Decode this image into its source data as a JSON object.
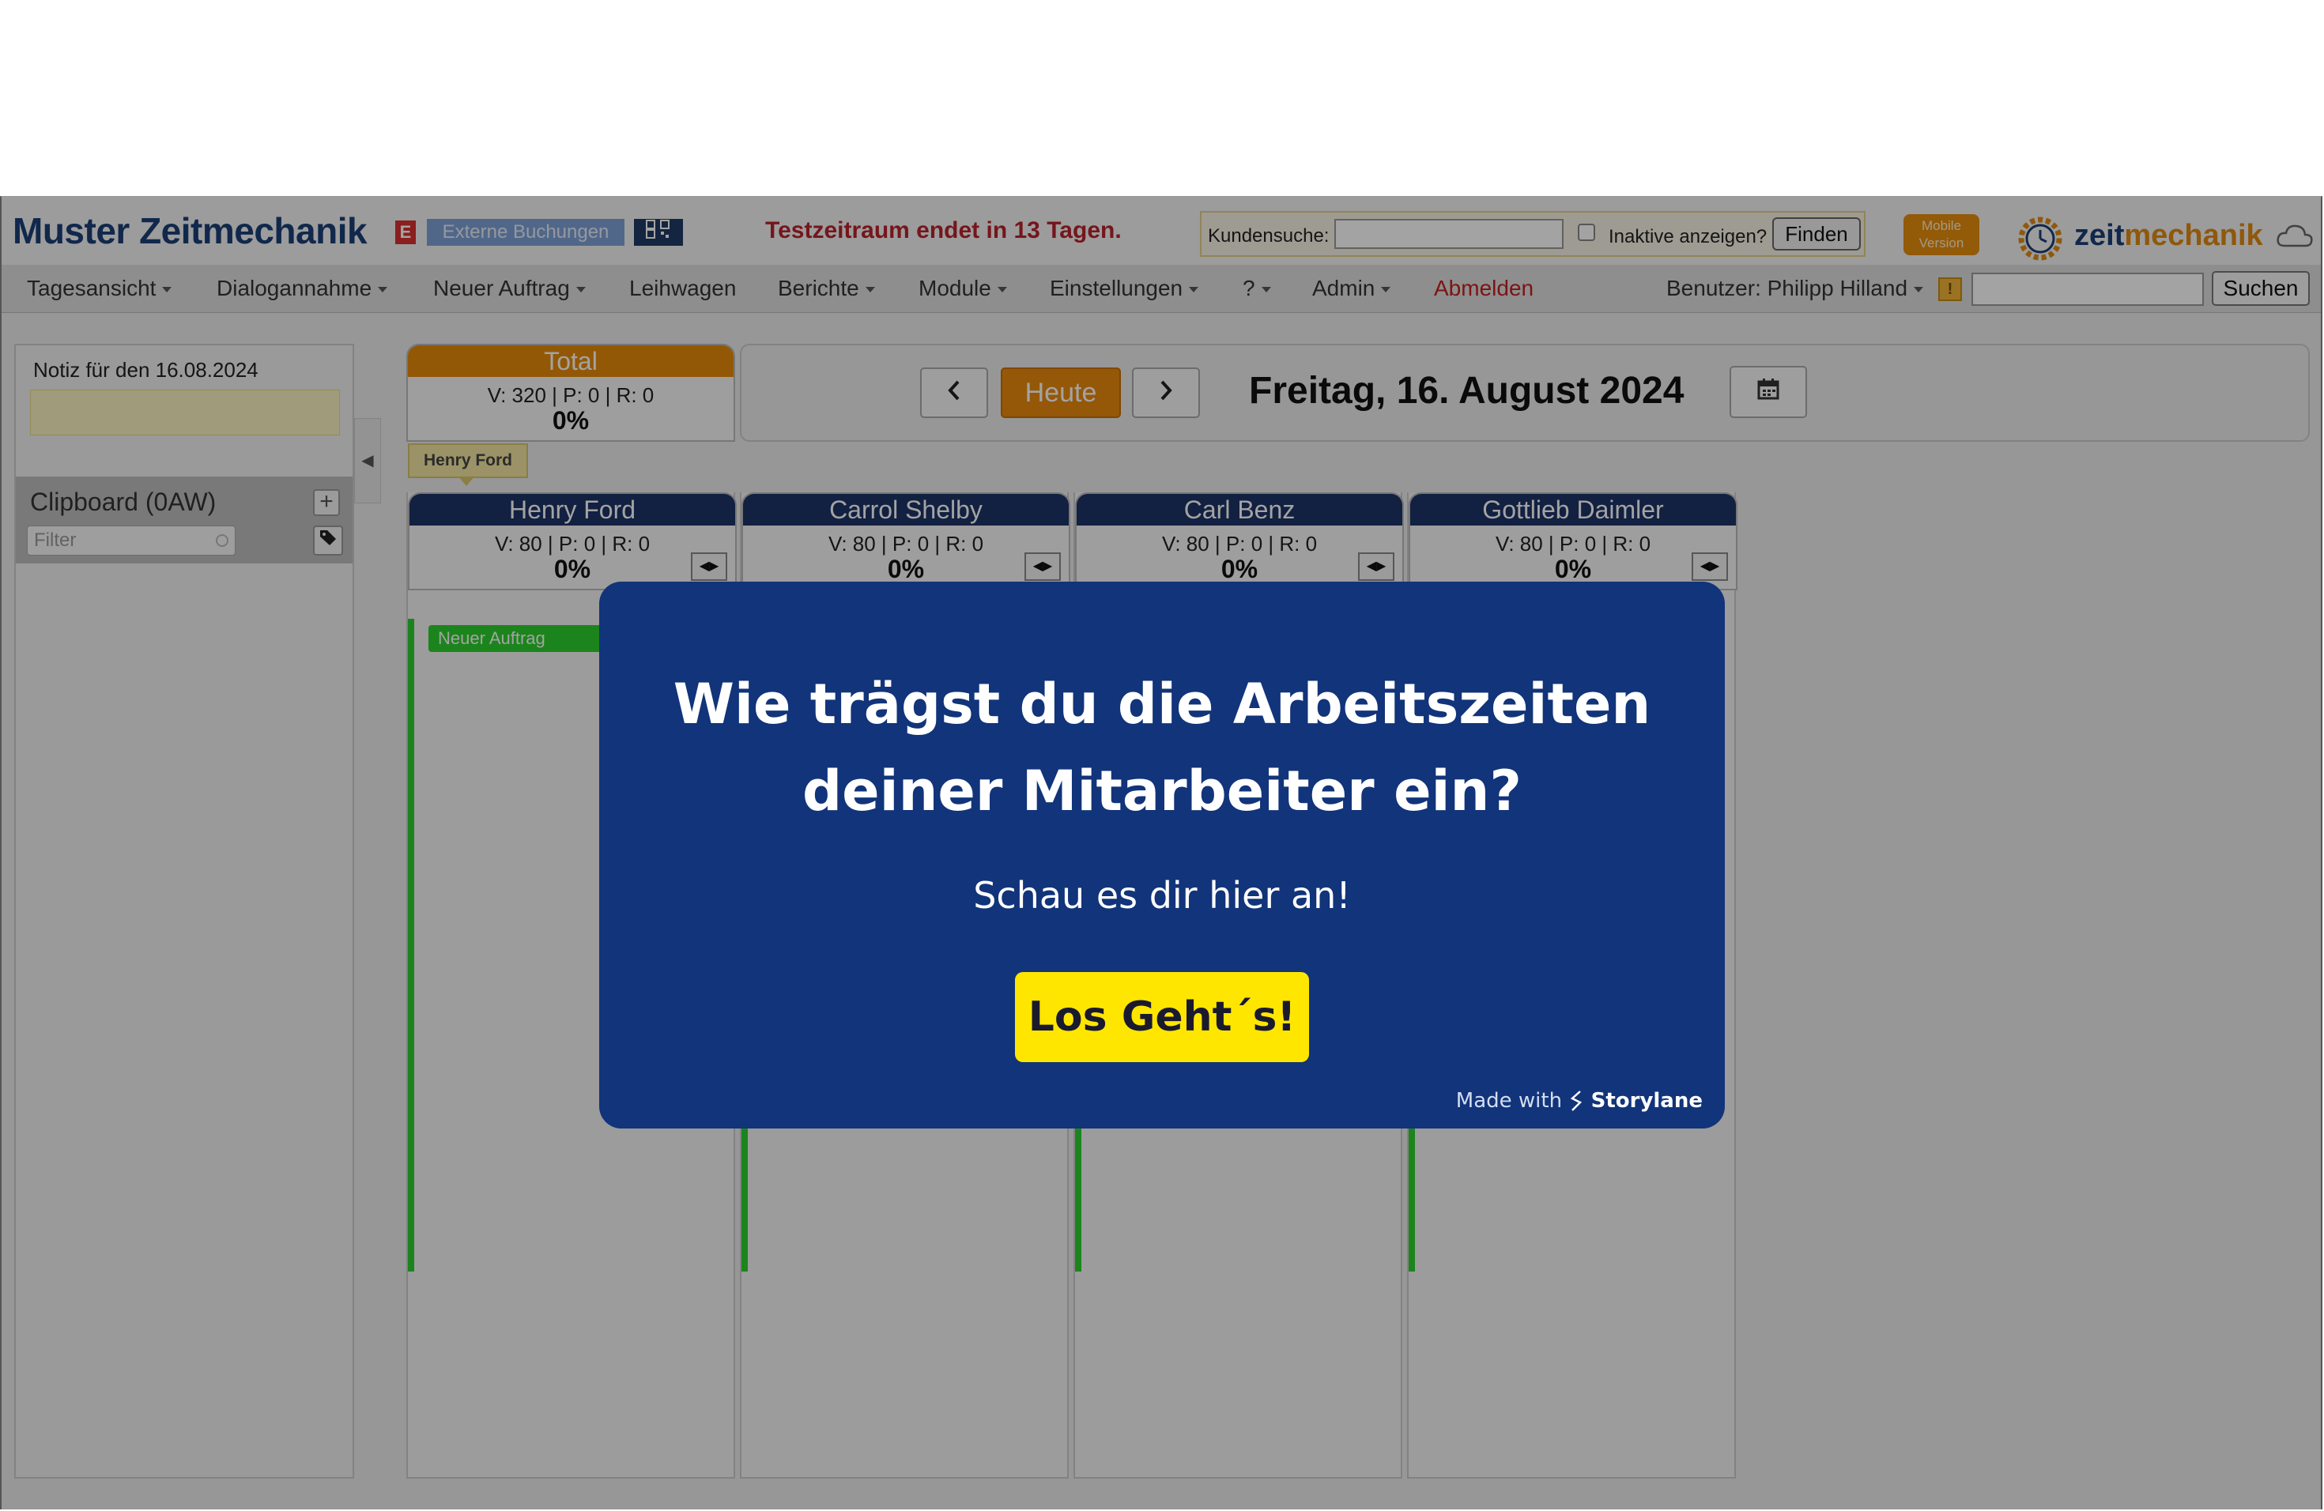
{
  "header": {
    "brand": "Muster Zeitmechanik",
    "brand_badge": "E",
    "external_bookings": "Externe Buchungen",
    "trial_notice": "Testzeitraum endet in 13 Tagen.",
    "customer_search_label": "Kundensuche:",
    "customer_search_value": "",
    "inactive_label": "Inaktive anzeigen?",
    "find_button": "Finden",
    "mobile_version": "Mobile Version",
    "logo_zeit": "zeit",
    "logo_mechanik": "mechanik",
    "icons": [
      "qr-code-icon",
      "gear-clock-logo-icon",
      "cloud-icon"
    ]
  },
  "nav": {
    "items": [
      {
        "label": "Tagesansicht",
        "dropdown": true
      },
      {
        "label": "Dialogannahme",
        "dropdown": true
      },
      {
        "label": "Neuer Auftrag",
        "dropdown": true
      },
      {
        "label": "Leihwagen",
        "dropdown": false
      },
      {
        "label": "Berichte",
        "dropdown": true
      },
      {
        "label": "Module",
        "dropdown": true
      },
      {
        "label": "Einstellungen",
        "dropdown": true
      },
      {
        "label": "?",
        "dropdown": true
      },
      {
        "label": "Admin",
        "dropdown": true
      },
      {
        "label": "Abmelden",
        "dropdown": false
      }
    ],
    "user_label": "Benutzer: Philipp Hilland",
    "warning_icon_text": "!",
    "search_value": "",
    "search_button": "Suchen"
  },
  "sidebar": {
    "note_label": "Notiz für den 16.08.2024",
    "note_value": "",
    "clipboard_title": "Clipboard (0AW)",
    "filter_placeholder": "Filter"
  },
  "total": {
    "label": "Total",
    "stats": "V: 320 | P: 0 | R: 0",
    "percent": "0%"
  },
  "datebar": {
    "today_button": "Heute",
    "date_title": "Freitag, 16. August 2024"
  },
  "tooltip": "Henry Ford",
  "employees": [
    {
      "name": "Henry Ford",
      "stats": "V: 80 | P: 0 | R: 0",
      "percent": "0%",
      "job": "Neuer Auftrag"
    },
    {
      "name": "Carrol Shelby",
      "stats": "V: 80 | P: 0 | R: 0",
      "percent": "0%"
    },
    {
      "name": "Carl Benz",
      "stats": "V: 80 | P: 0 | R: 0",
      "percent": "0%"
    },
    {
      "name": "Gottlieb Daimler",
      "stats": "V: 80 | P: 0 | R: 0",
      "percent": "0%"
    }
  ],
  "modal": {
    "title_line1": "Wie trägst du die Arbeitszeiten",
    "title_line2": "deiner Mitarbeiter ein?",
    "subtitle": "Schau es dir hier an!",
    "cta_button": "Los Geht´s!",
    "made_with": "Made with",
    "made_brand": "Storylane"
  },
  "colors": {
    "brand_blue": "#1c3f78",
    "accent_orange": "#e68a0a",
    "column_header": "#1d3366",
    "job_green": "#2dcf2d",
    "modal_bg": "#11347a",
    "cta_yellow": "#ffe600",
    "trial_red": "#b8232d"
  }
}
